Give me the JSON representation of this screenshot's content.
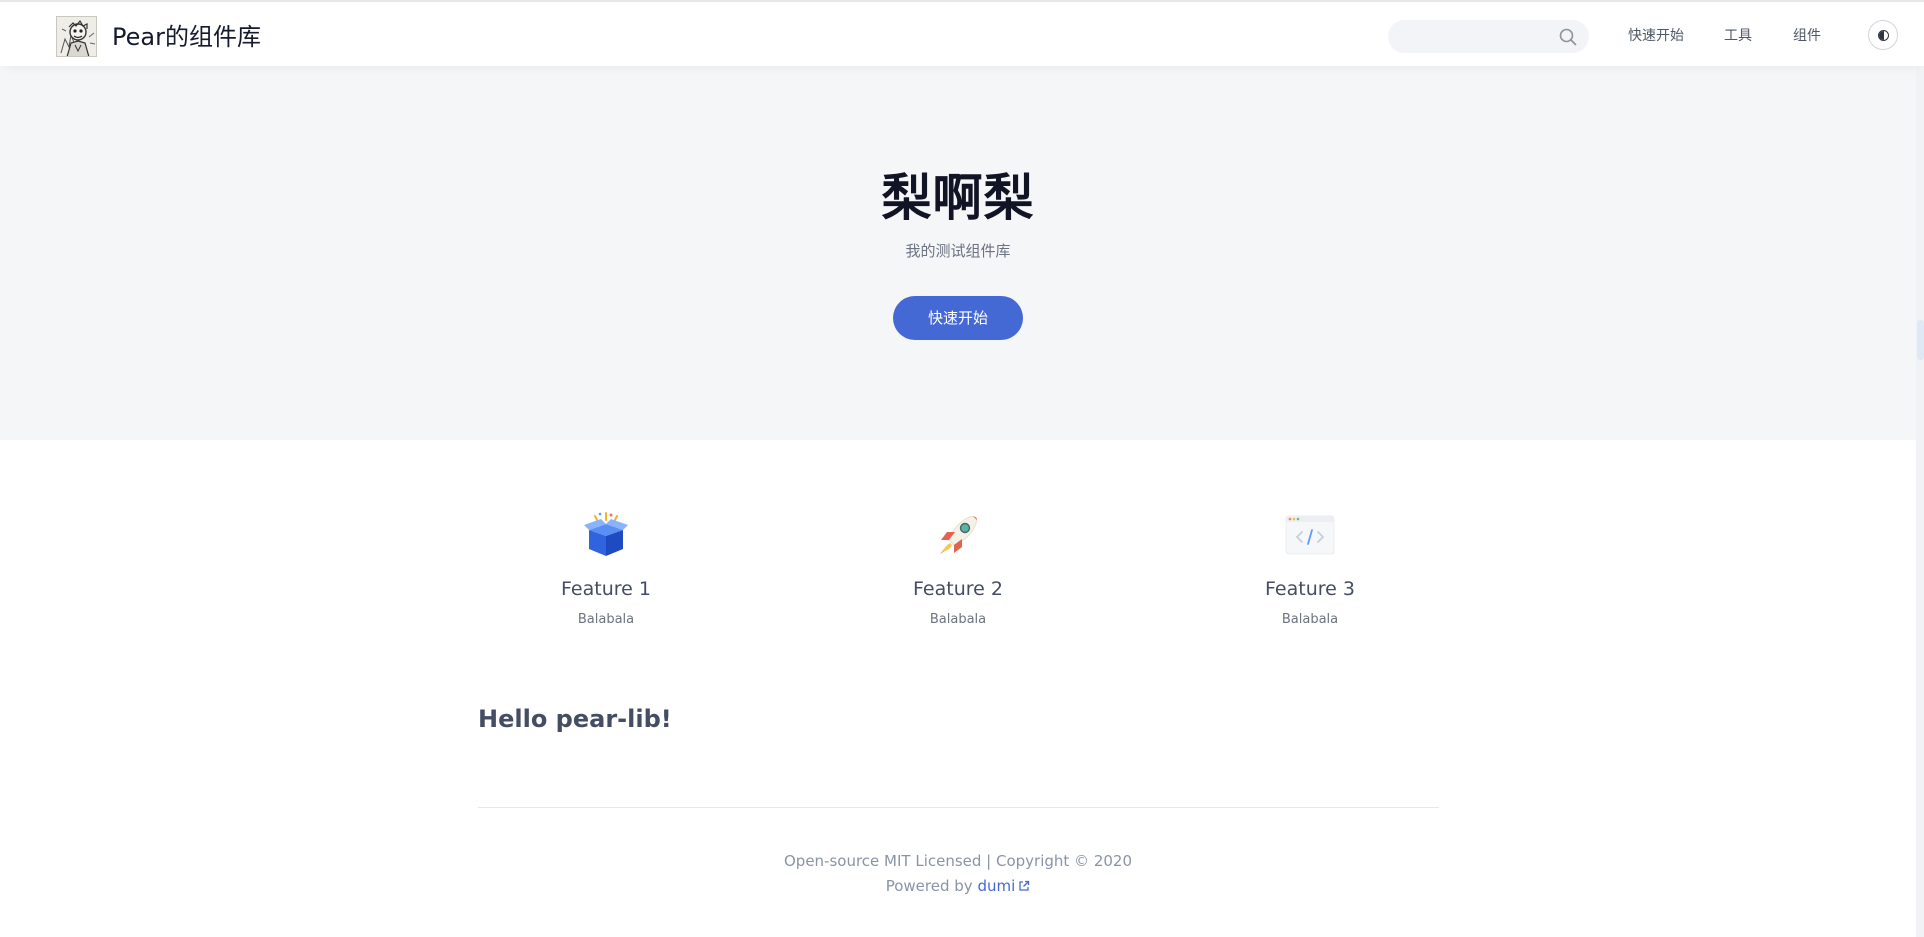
{
  "navbar": {
    "logo_icon": "avatar-sketch-logo",
    "title": "Pear的组件库",
    "search": {
      "value": "",
      "placeholder": "",
      "icon": "search-icon"
    },
    "links": [
      {
        "label": "快速开始"
      },
      {
        "label": "工具"
      },
      {
        "label": "组件"
      }
    ],
    "theme_toggle_icon": "theme-contrast-icon"
  },
  "hero": {
    "title": "梨啊梨",
    "description": "我的测试组件库",
    "action_label": "快速开始"
  },
  "features": [
    {
      "icon": "open-box-icon",
      "title": "Feature 1",
      "description": "Balabala"
    },
    {
      "icon": "rocket-icon",
      "title": "Feature 2",
      "description": "Balabala"
    },
    {
      "icon": "code-window-icon",
      "title": "Feature 3",
      "description": "Balabala"
    }
  ],
  "content": {
    "heading": "Hello pear-lib!"
  },
  "footer": {
    "license_text": "Open-source MIT Licensed | Copyright © 2020",
    "powered_prefix": "Powered by",
    "powered_link": "dumi",
    "external_icon": "external-link-icon"
  },
  "colors": {
    "accent": "#4569d4",
    "hero_background": "#f5f6f8",
    "heading_text": "#111424",
    "body_text": "#454d64",
    "muted_text": "#8a94a6"
  }
}
